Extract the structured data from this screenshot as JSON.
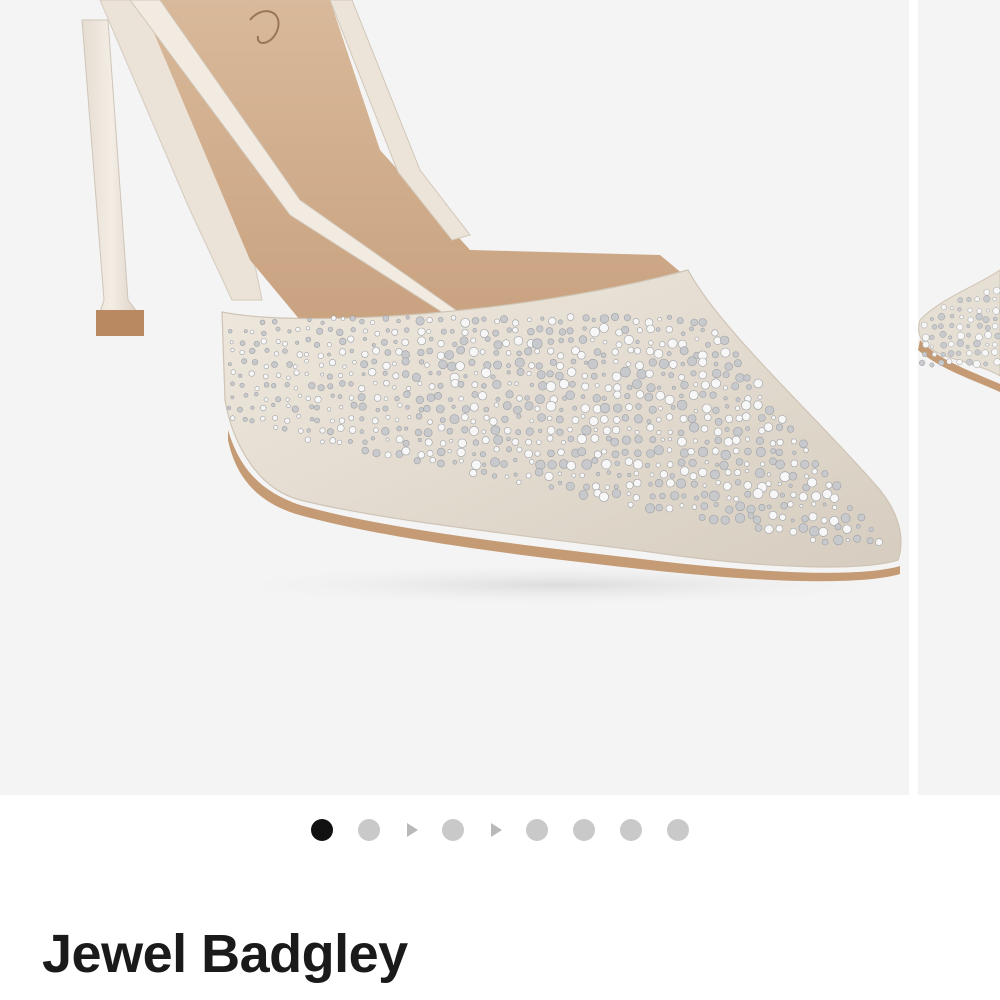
{
  "product": {
    "title": "Jewel Badgley"
  },
  "gallery": {
    "active_index": 0,
    "indicators": [
      {
        "type": "dot",
        "state": "active"
      },
      {
        "type": "dot",
        "state": "inactive"
      },
      {
        "type": "video-play-icon",
        "state": "inactive"
      },
      {
        "type": "dot",
        "state": "inactive"
      },
      {
        "type": "video-play-icon",
        "state": "inactive"
      },
      {
        "type": "dot",
        "state": "inactive"
      },
      {
        "type": "dot",
        "state": "inactive"
      },
      {
        "type": "dot",
        "state": "inactive"
      },
      {
        "type": "dot",
        "state": "inactive"
      }
    ]
  },
  "colors": {
    "active_dot": "#111111",
    "inactive_dot": "#c9c9c9",
    "image_background": "#f4f4f4",
    "title_text": "#1a1a1a"
  }
}
